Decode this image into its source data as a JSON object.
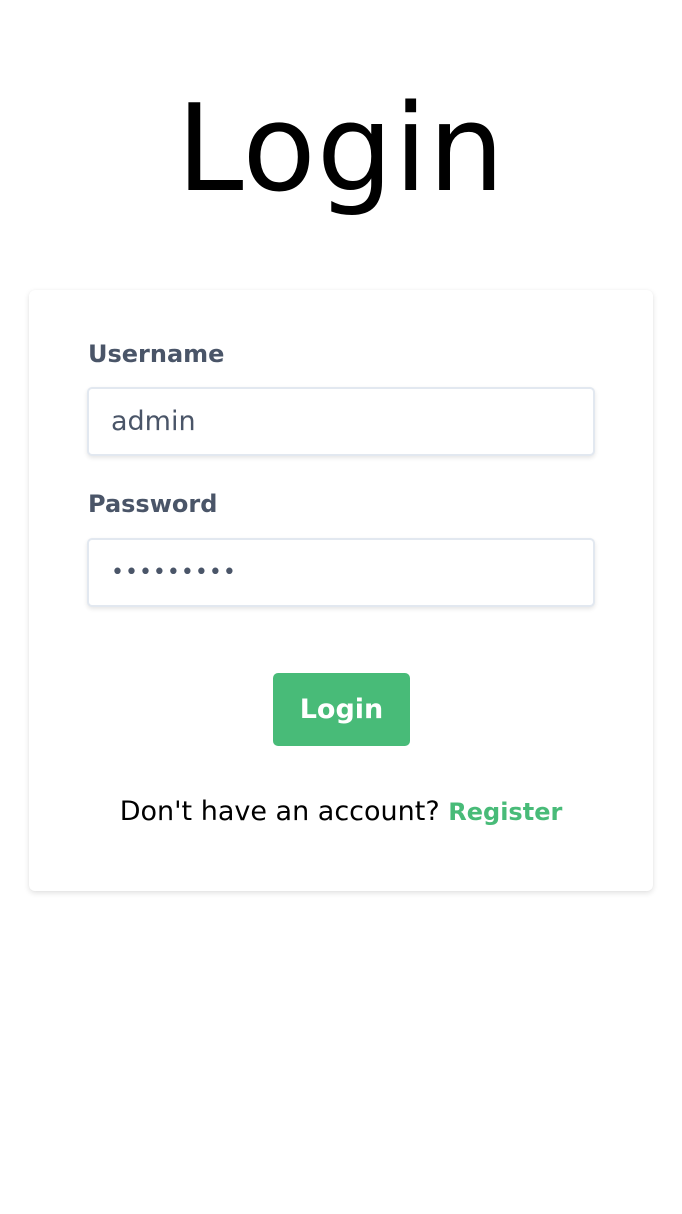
{
  "page": {
    "title": "Login"
  },
  "form": {
    "username_label": "Username",
    "username_value": "admin",
    "password_label": "Password",
    "password_masked": "•••••••••",
    "submit_label": "Login"
  },
  "footer": {
    "prompt": "Don't have an account?",
    "register_label": "Register"
  },
  "colors": {
    "accent": "#48bb78",
    "label": "#4a5568",
    "input_border": "#e2e8f0"
  }
}
